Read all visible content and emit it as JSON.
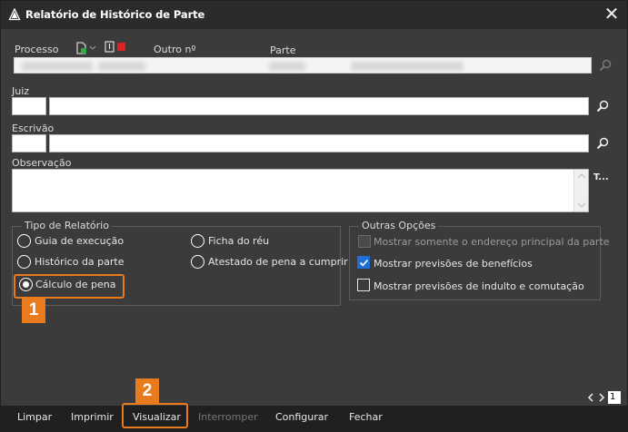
{
  "window": {
    "title": "Relatório de Histórico de Parte",
    "close_glyph": "✕"
  },
  "labels": {
    "processo": "Processo",
    "outro": "Outro nº",
    "parte": "Parte",
    "juiz": "Juiz",
    "escrivao": "Escrivão",
    "observacao": "Observação",
    "text_tool": "T..."
  },
  "tipo": {
    "title": "Tipo de Relatório",
    "options": [
      "Guia de execução",
      "Ficha do réu",
      "Histórico da parte",
      "Atestado de pena a cumprir",
      "Cálculo de pena"
    ],
    "selected": "Cálculo de pena"
  },
  "outras": {
    "title": "Outras Opções",
    "options": [
      {
        "label": "Mostrar somente o endereço principal da parte",
        "checked": false,
        "enabled": false
      },
      {
        "label": "Mostrar previsões de benefícios",
        "checked": true,
        "enabled": true
      },
      {
        "label": "Mostrar previsões de indulto e comutação",
        "checked": false,
        "enabled": true
      }
    ]
  },
  "badges": {
    "one": "1",
    "two": "2"
  },
  "pager": {
    "page": "1"
  },
  "buttons": {
    "limpar": "Limpar",
    "imprimir": "Imprimir",
    "visualizar": "Visualizar",
    "interromper": "Interromper",
    "configurar": "Configurar",
    "fechar": "Fechar"
  },
  "colors": {
    "accent_orange": "#e87b1e",
    "checkbox_blue": "#1f6fd6",
    "red_icon": "#e02020",
    "green_icon": "#2fa84f"
  }
}
